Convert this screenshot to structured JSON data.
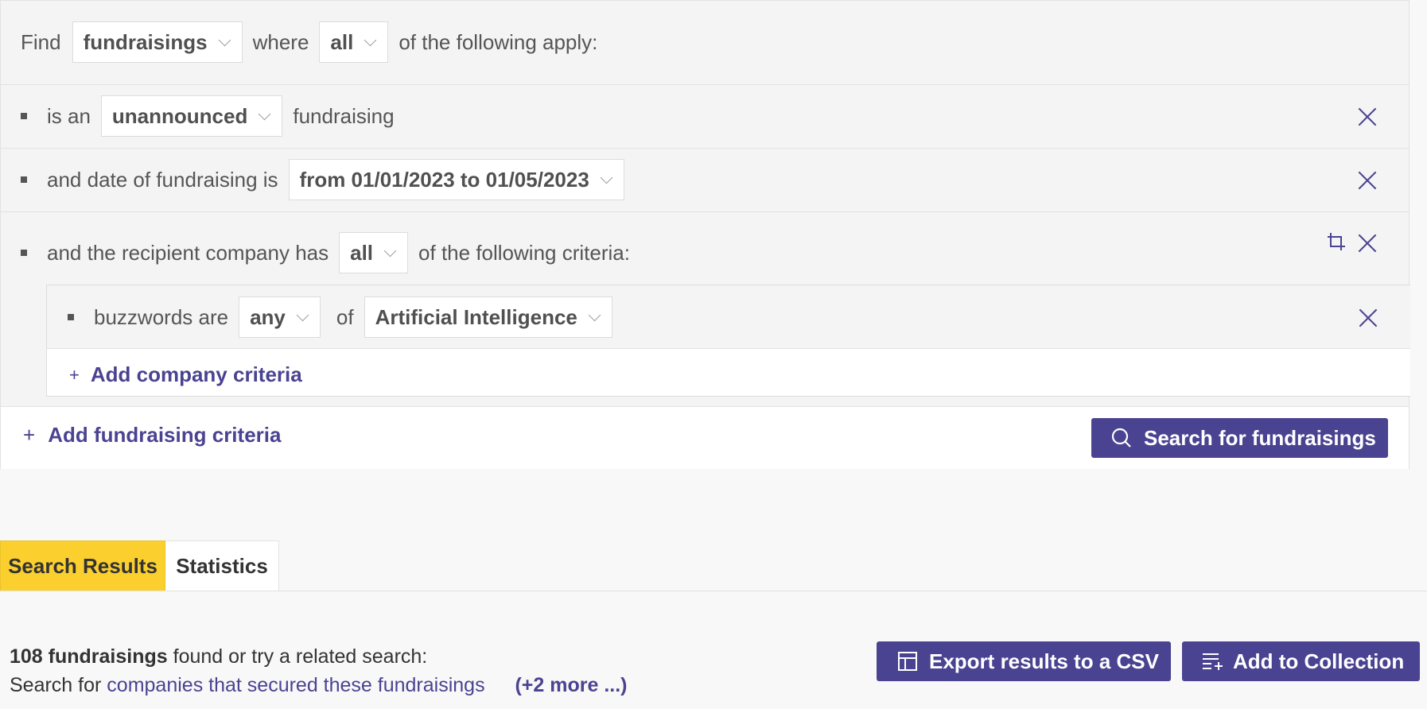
{
  "query": {
    "find_label": "Find",
    "entity": "fundraisings",
    "where_label": "where",
    "match": "all",
    "suffix": "of the following apply:"
  },
  "criteria": [
    {
      "prefix": "is an",
      "value": "unannounced",
      "suffix": "fundraising"
    },
    {
      "prefix": "and date of fundraising is",
      "value": "from 01/01/2023 to 01/05/2023"
    },
    {
      "prefix": "and the recipient company has",
      "value": "all",
      "suffix": "of the following criteria:"
    }
  ],
  "nested": {
    "prefix": "buzzwords are",
    "match": "any",
    "of_label": "of",
    "value": "Artificial Intelligence",
    "add_label": "Add company criteria"
  },
  "add_fundraising_label": "Add fundraising criteria",
  "search_button_label": "Search for fundraisings",
  "tabs": [
    "Search Results",
    "Statistics"
  ],
  "results": {
    "count": "108 fundraisings",
    "found_text": "found or try a related search:",
    "search_for": "Search for",
    "related_link": "companies that secured these fundraisings",
    "more_link": "(+2 more ...)"
  },
  "export_label": "Export results to a CSV",
  "collection_label": "Add to Collection",
  "colors": {
    "accent": "#4a4391",
    "tab_active": "#fbd02e"
  }
}
